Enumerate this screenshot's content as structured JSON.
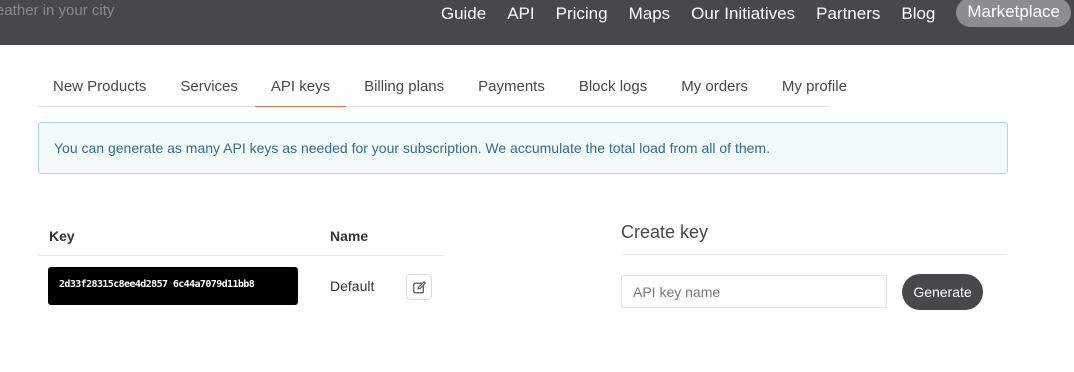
{
  "navbar": {
    "search_placeholder": "eather in your city",
    "links": [
      "Guide",
      "API",
      "Pricing",
      "Maps",
      "Our Initiatives",
      "Partners",
      "Blog"
    ],
    "marketplace_label": "Marketplace"
  },
  "tabs": [
    {
      "label": "New Products",
      "active": false
    },
    {
      "label": "Services",
      "active": false
    },
    {
      "label": "API keys",
      "active": true
    },
    {
      "label": "Billing plans",
      "active": false
    },
    {
      "label": "Payments",
      "active": false
    },
    {
      "label": "Block logs",
      "active": false
    },
    {
      "label": "My orders",
      "active": false
    },
    {
      "label": "My profile",
      "active": false
    }
  ],
  "alert": {
    "text": "You can generate as many API keys as needed for your subscription. We accumulate the total load from all of them."
  },
  "keys_table": {
    "headers": {
      "key": "Key",
      "name": "Name"
    },
    "rows": [
      {
        "key": "2d33f28315c8ee4d2857 6c44a7079d11bb8",
        "name": "Default"
      }
    ],
    "edit_icon": "edit-icon"
  },
  "create_key": {
    "title": "Create key",
    "input_placeholder": "API key name",
    "generate_label": "Generate"
  },
  "colors": {
    "navbar_bg": "#48484a",
    "active_tab_underline": "#e96e50",
    "alert_bg": "#f2fafa",
    "alert_border": "#a8dcd8",
    "alert_text": "#2f6f8a",
    "button_bg": "#48484a"
  }
}
